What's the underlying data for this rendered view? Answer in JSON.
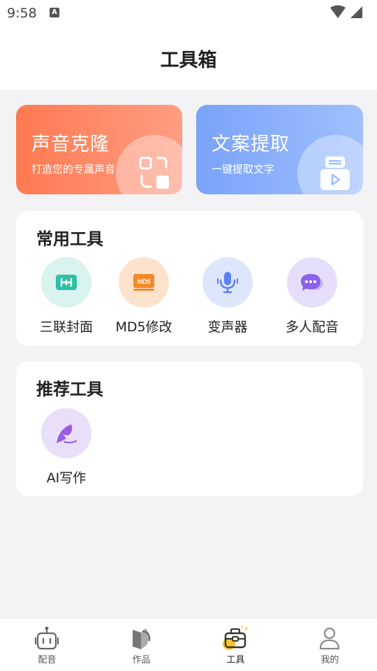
{
  "status_bar": {
    "time": "9:58",
    "notification_badge": "A"
  },
  "header": {
    "title": "工具箱"
  },
  "feature_cards": [
    {
      "title": "声音克隆",
      "subtitle": "打造您的专属声音"
    },
    {
      "title": "文案提取",
      "subtitle": "一键提取文字"
    }
  ],
  "common_tools": {
    "title": "常用工具",
    "items": [
      {
        "label": "三联封面",
        "icon": "triptych-cover-icon"
      },
      {
        "label": "MD5修改",
        "icon": "md5-icon",
        "badge": "MD5"
      },
      {
        "label": "变声器",
        "icon": "microphone-icon"
      },
      {
        "label": "多人配音",
        "icon": "chat-bubble-icon"
      }
    ]
  },
  "recommended_tools": {
    "title": "推荐工具",
    "items": [
      {
        "label": "AI写作",
        "icon": "quill-pen-icon"
      }
    ]
  },
  "tab_bar": {
    "active": "工具",
    "items": [
      {
        "label": "配音",
        "icon": "robot-icon"
      },
      {
        "label": "作品",
        "icon": "works-icon"
      },
      {
        "label": "工具",
        "icon": "toolbox-icon"
      },
      {
        "label": "我的",
        "icon": "user-icon"
      }
    ]
  },
  "colors": {
    "voice_card": "#ff7a51",
    "text_card": "#7aa3f8",
    "triptych": "#2fbfa6",
    "md5": "#f28a2a",
    "mic": "#5a80f2",
    "chat": "#8a63e8",
    "quill": "#9b5de5",
    "active_tab_accent": "#f7c52c"
  }
}
